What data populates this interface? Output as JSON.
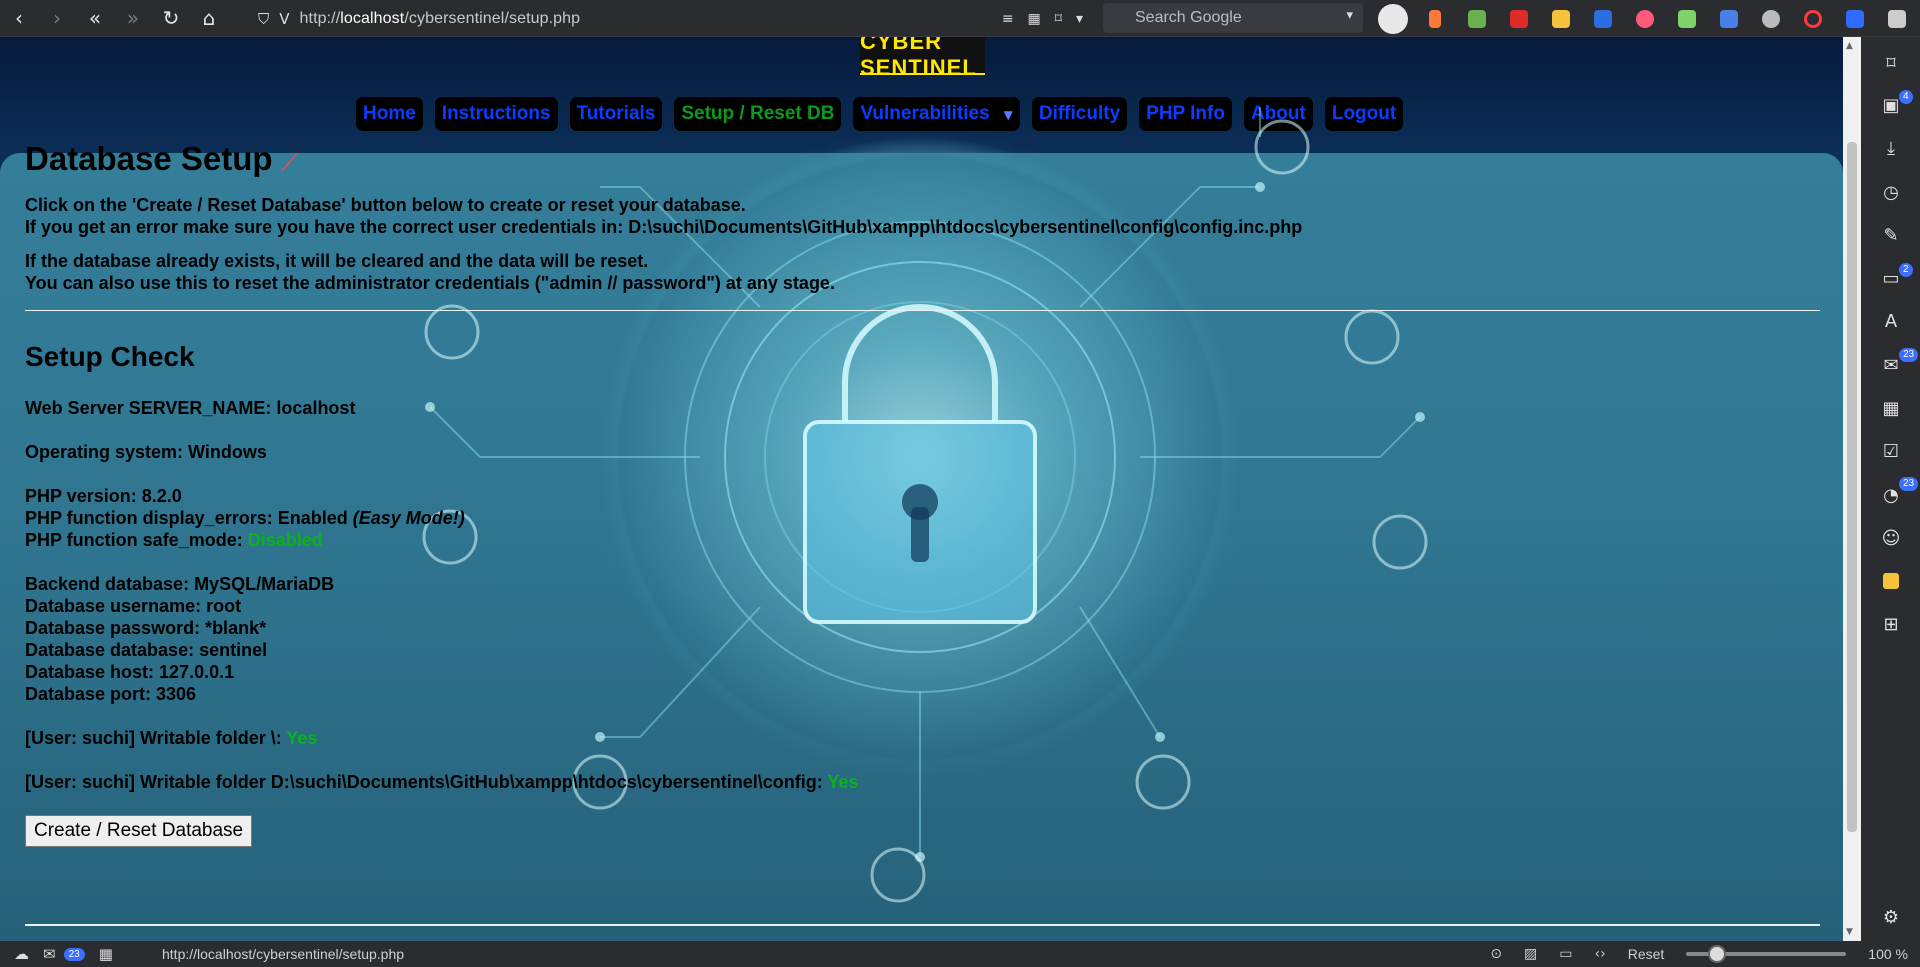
{
  "browser": {
    "url_prefix": "http://",
    "url_host": "localhost",
    "url_path": "/cybersentinel/setup.php",
    "search_placeholder": "Search Google"
  },
  "site": {
    "logo_text": "CYBER SENTINEL",
    "nav": [
      {
        "label": "Home"
      },
      {
        "label": "Instructions"
      },
      {
        "label": "Tutorials"
      },
      {
        "label": "Setup / Reset DB"
      },
      {
        "label": "Vulnerabilities"
      },
      {
        "label": "Difficulty"
      },
      {
        "label": "PHP Info"
      },
      {
        "label": "About"
      },
      {
        "label": "Logout"
      }
    ],
    "vulnerabilities_caret": "▼"
  },
  "page": {
    "title": "Database Setup",
    "intro1": "Click on the 'Create / Reset Database' button below to create or reset your database.",
    "intro2": "If you get an error make sure you have the correct user credentials in: D:\\suchi\\Documents\\GitHub\\xampp\\htdocs\\cybersentinel\\config\\config.inc.php",
    "intro3": "If the database already exists, it will be cleared and the data will be reset.",
    "intro4": "You can also use this to reset the administrator credentials (\"admin // password\") at any stage.",
    "check_title": "Setup Check",
    "server_name": "Web Server SERVER_NAME: localhost",
    "os": "Operating system: Windows",
    "php_version": "PHP version: 8.2.0",
    "display_errors_label": "PHP function display_errors: Enabled ",
    "display_errors_note": "(Easy Mode!)",
    "safe_mode_label": "PHP function safe_mode: ",
    "safe_mode_value": "Disabled",
    "backend": "Backend database: MySQL/MariaDB",
    "db_user": "Database username: root",
    "db_pass": "Database password: *blank*",
    "db_name": "Database database: sentinel",
    "db_host": "Database host: 127.0.0.1",
    "db_port": "Database port: 3306",
    "writable1_label": "[User: suchi] Writable folder \\: ",
    "writable1_value": "Yes",
    "writable2_label": "[User: suchi] Writable folder D:\\suchi\\Documents\\GitHub\\xampp\\htdocs\\cybersentinel\\config: ",
    "writable2_value": "Yes",
    "button": "Create / Reset Database"
  },
  "sidebar_badges": {
    "panels": "4",
    "calendar": "2",
    "mail": "23",
    "feeds": "23"
  },
  "status": {
    "mail_badge": "23",
    "hover_url": "http://localhost/cybersentinel/setup.php",
    "reset": "Reset",
    "zoom": "100 %"
  }
}
